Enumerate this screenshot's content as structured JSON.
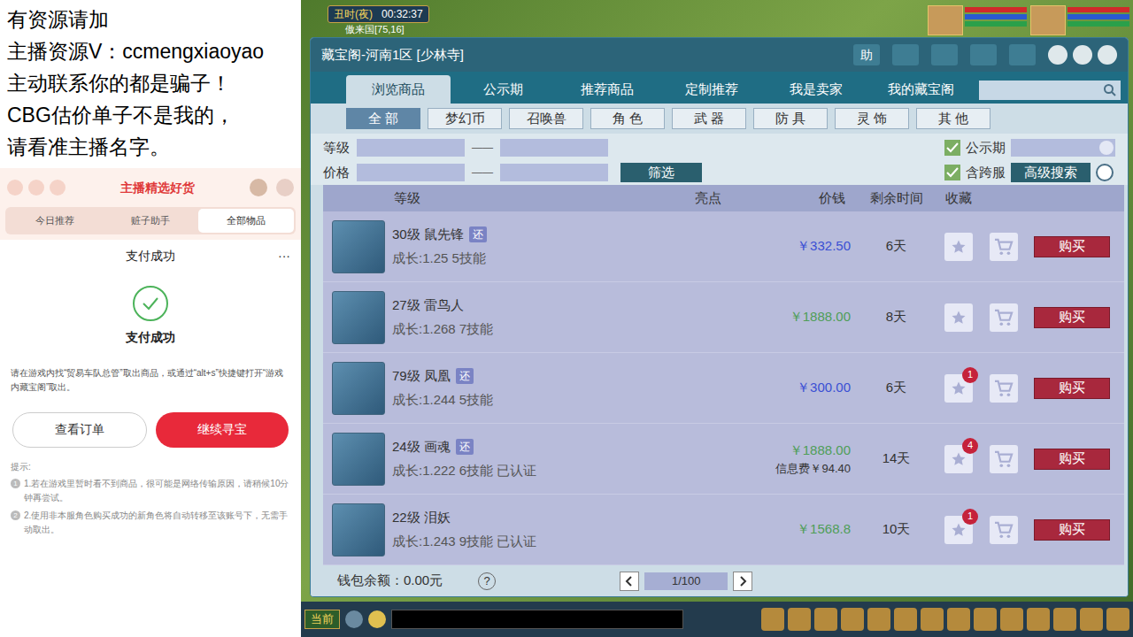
{
  "stream_notice": {
    "lines": [
      "有资源请加",
      "主播资源V：ccmengxiaoyao",
      "主动联系你的都是骗子！",
      "CBG估价单子不是我的，",
      "请看准主播名字。"
    ]
  },
  "mobile": {
    "header": "主播精选好货",
    "tabs": [
      {
        "label": "今日推荐",
        "selected": false
      },
      {
        "label": "赃子助手",
        "selected": false
      },
      {
        "label": "全部物品",
        "selected": true
      }
    ],
    "page_title": "支付成功",
    "menu": "···",
    "status": "支付成功",
    "description": "请在游戏内找“贸易车队总管”取出商品，或通过“alt+s”快捷键打开“游戏内藏宝阁”取出。",
    "buttons": [
      {
        "label": "查看订单",
        "kind": "outline"
      },
      {
        "label": "继续寻宝",
        "kind": "primary"
      }
    ],
    "tips_label": "提示:",
    "tips": [
      {
        "number": "1",
        "text": "1.若在游戏里暂时看不到商品，很可能是网络传输原因，请稍候10分钟再尝试。"
      },
      {
        "number": "2",
        "text": "2.使用非本服角色购买成功的新角色将自动转移至该账号下，无需手动取出。"
      }
    ]
  },
  "game": {
    "period": "丑时(夜)",
    "clock": "00:32:37",
    "location": "傲来国[75,16]",
    "chat_channel": "当前"
  },
  "window": {
    "title": "藏宝阁-河南1区 [少林寺]",
    "help": "助",
    "tabs": [
      {
        "label": "浏览商品",
        "selected": true
      },
      {
        "label": "公示期",
        "selected": false
      },
      {
        "label": "推荐商品",
        "selected": false
      },
      {
        "label": "定制推荐",
        "selected": false
      },
      {
        "label": "我是卖家",
        "selected": false
      },
      {
        "label": "我的藏宝阁",
        "selected": false
      }
    ],
    "categories": [
      {
        "label": "全 部",
        "selected": true
      },
      {
        "label": "梦幻币",
        "selected": false
      },
      {
        "label": "召唤兽",
        "selected": false
      },
      {
        "label": "角 色",
        "selected": false
      },
      {
        "label": "武 器",
        "selected": false
      },
      {
        "label": "防 具",
        "selected": false
      },
      {
        "label": "灵 饰",
        "selected": false
      },
      {
        "label": "其 他",
        "selected": false
      }
    ],
    "filters": {
      "level_label": "等级",
      "price_label": "价格",
      "dash": "——",
      "filter_button": "筛选",
      "checks": [
        {
          "label": "公示期",
          "checked": true
        },
        {
          "label": "含跨服",
          "checked": true
        }
      ],
      "advanced_button": "高级搜索"
    },
    "columns": [
      "等级",
      "亮点",
      "价钱",
      "剩余时间",
      "收藏"
    ],
    "rows": [
      {
        "name": "30级 鼠先锋",
        "badge": "还",
        "detail": "成长:1.25 5技能",
        "price": "￥332.50",
        "fee": "",
        "color": "#3b50d4",
        "time": "6天",
        "favorites": ""
      },
      {
        "name": "27级 雷鸟人",
        "badge": "",
        "detail": "成长:1.268 7技能",
        "price": "￥1888.00",
        "fee": "",
        "color": "#4f9e58",
        "time": "8天",
        "favorites": ""
      },
      {
        "name": "79级 凤凰",
        "badge": "还",
        "detail": "成长:1.244 5技能",
        "price": "￥300.00",
        "fee": "",
        "color": "#3b50d4",
        "time": "6天",
        "favorites": "1"
      },
      {
        "name": "24级 画魂",
        "badge": "还",
        "detail": "成长:1.222 6技能 已认证",
        "price": "￥1888.00",
        "fee": "信息费￥94.40",
        "color": "#4f9e58",
        "time": "14天",
        "favorites": "4"
      },
      {
        "name": "22级 泪妖",
        "badge": "",
        "detail": "成长:1.243 9技能 已认证",
        "price": "￥1568.8",
        "fee": "",
        "color": "#4f9e58",
        "time": "10天",
        "favorites": "1"
      }
    ],
    "buy_button": "购买",
    "footer": {
      "wallet": "钱包余额：0.00元",
      "help": "?",
      "page": "1/100"
    }
  }
}
